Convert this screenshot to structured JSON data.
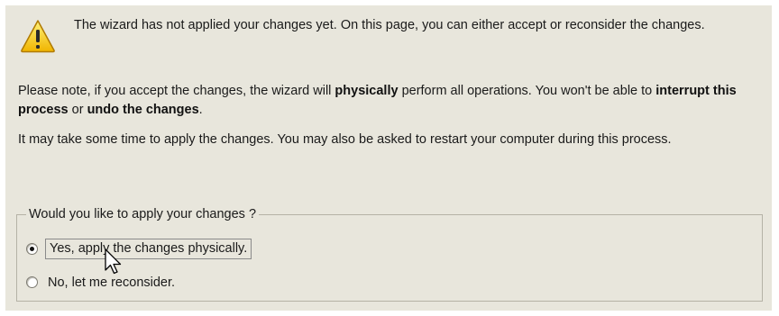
{
  "warning": {
    "icon": "warning-icon",
    "text": "The wizard has not applied your changes yet. On this page, you can either accept or reconsider the changes."
  },
  "note": {
    "text_1": "Please note, if you accept the changes, the wizard will ",
    "bold_1": "physically",
    "text_2": " perform all operations. You won't be able to ",
    "bold_2": "interrupt this process",
    "text_3": " or ",
    "bold_3": "undo the changes",
    "text_4": "."
  },
  "info": {
    "text": "It may take some time to apply the changes. You may also be asked to restart your computer during this process."
  },
  "apply_group": {
    "legend": "Would you like to apply your changes ?",
    "options": [
      {
        "label": "Yes, apply the changes physically.",
        "selected": true
      },
      {
        "label": "No, let me reconsider.",
        "selected": false
      }
    ]
  },
  "colors": {
    "panel_background": "#e8e6dc",
    "warning_yellow": "#f5c400",
    "group_border": "#b5b2a6"
  }
}
